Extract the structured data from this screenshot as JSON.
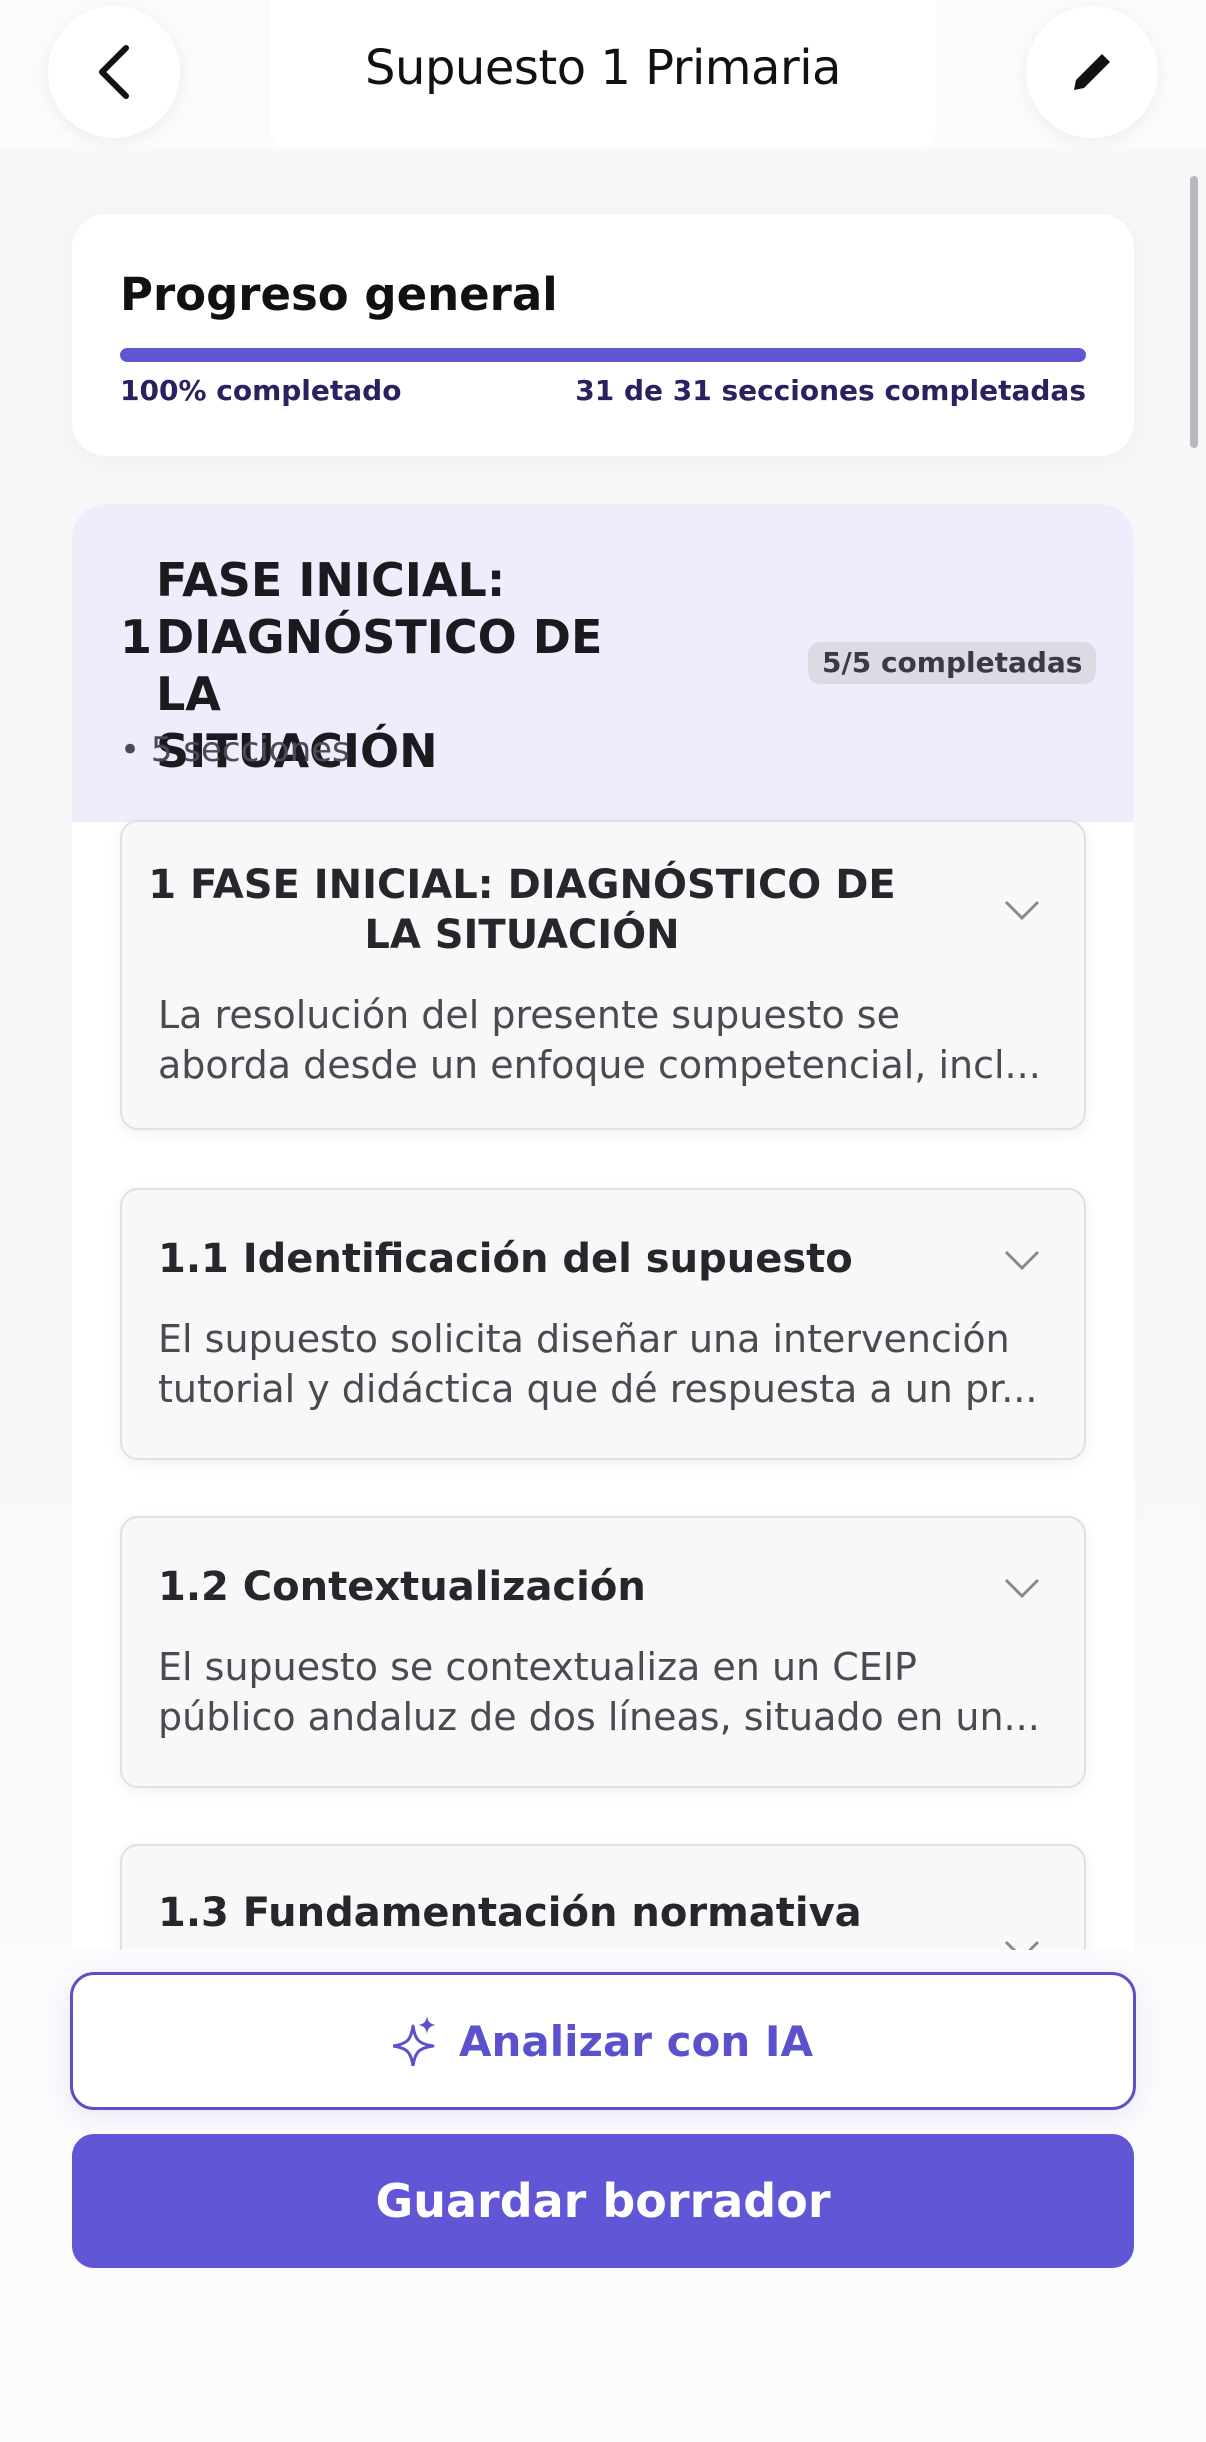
{
  "header": {
    "title": "Supuesto 1 Primaria",
    "back_icon": "chevron-left-icon",
    "edit_icon": "pencil-icon"
  },
  "progress": {
    "title": "Progreso general",
    "percent": 100,
    "percent_label": "100% completado",
    "sections_label": "31 de 31 secciones completadas"
  },
  "phase": {
    "number": "1",
    "title_lines": [
      "FASE INICIAL:",
      "DIAGNÓSTICO DE LA",
      "SITUACIÓN"
    ],
    "sections_label": "• 5 secciones",
    "badge": "5/5 completadas"
  },
  "sections": [
    {
      "title_lines": [
        "1 FASE INICIAL: DIAGNÓSTICO DE",
        "LA SITUACIÓN"
      ],
      "desc_lines": [
        "La resolución del presente supuesto se",
        "aborda desde un enfoque competencial, incl..."
      ]
    },
    {
      "title_lines": [
        "1.1 Identificación del supuesto"
      ],
      "desc_lines": [
        "El supuesto solicita diseñar una intervención",
        "tutorial y didáctica que dé respuesta a un pr..."
      ]
    },
    {
      "title_lines": [
        "1.2 Contextualización"
      ],
      "desc_lines": [
        "El supuesto se contextualiza en un CEIP",
        "público andaluz de dos líneas, situado en un..."
      ]
    },
    {
      "title_lines": [
        "1.3 Fundamentación normativa"
      ],
      "desc_lines": []
    }
  ],
  "actions": {
    "analyze_label": "Analizar con IA",
    "analyze_icon": "sparkles-icon",
    "save_label": "Guardar borrador"
  },
  "colors": {
    "accent": "#6056d6",
    "phase_bg": "#efedfc",
    "progress_text": "#2a2160"
  }
}
